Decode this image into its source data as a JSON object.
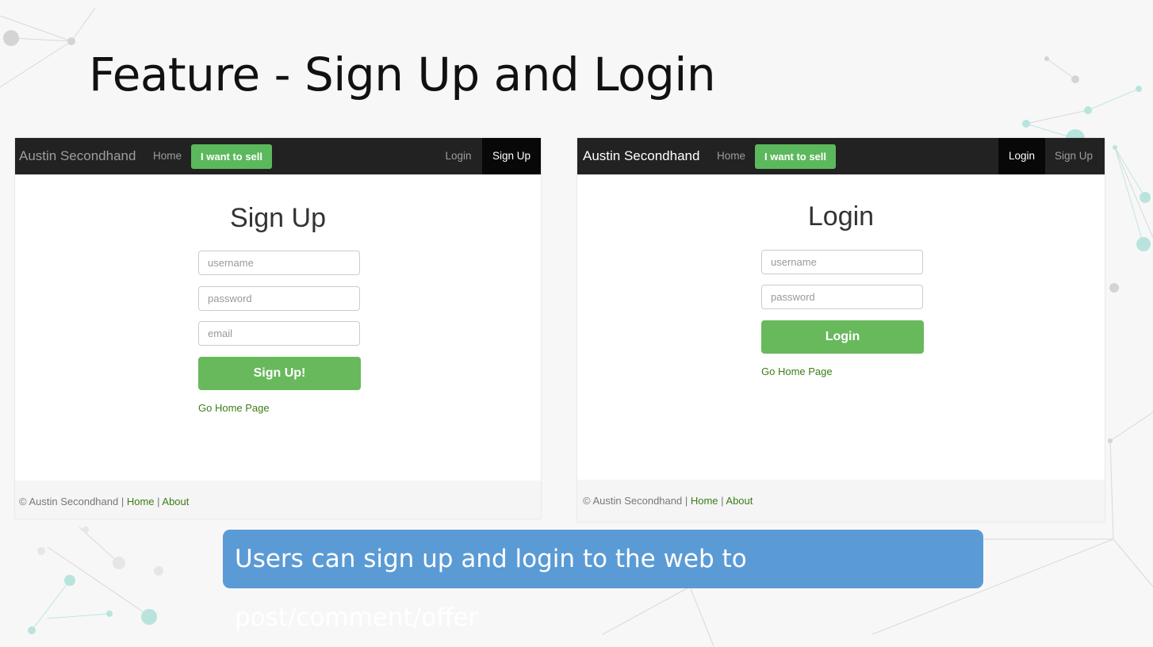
{
  "slide": {
    "title": "Feature - Sign Up and Login",
    "caption": "Users can sign up and login to the web to post/comment/offer"
  },
  "colors": {
    "navbar": "#222222",
    "brand_green": "#5cb85c",
    "link_green": "#3c7d17",
    "caption_blue": "#5b9bd5"
  },
  "signup_panel": {
    "nav": {
      "brand": "Austin Secondhand",
      "home": "Home",
      "sell": "I want to sell",
      "login": "Login",
      "signup": "Sign Up",
      "active": "Sign Up"
    },
    "title": "Sign Up",
    "fields": {
      "username_placeholder": "username",
      "password_placeholder": "password",
      "email_placeholder": "email"
    },
    "submit": "Sign Up!",
    "home_link": "Go Home Page",
    "footer": {
      "copyright": "© Austin Secondhand | ",
      "home": "Home",
      "separator": " | ",
      "about": "About"
    }
  },
  "login_panel": {
    "nav": {
      "brand": "Austin Secondhand",
      "home": "Home",
      "sell": "I want to sell",
      "login": "Login",
      "signup": "Sign Up",
      "active": "Login"
    },
    "title": "Login",
    "fields": {
      "username_placeholder": "username",
      "password_placeholder": "password"
    },
    "submit": "Login",
    "home_link": "Go Home Page",
    "footer": {
      "copyright": "© Austin Secondhand | ",
      "home": "Home",
      "separator": " | ",
      "about": "About"
    }
  }
}
